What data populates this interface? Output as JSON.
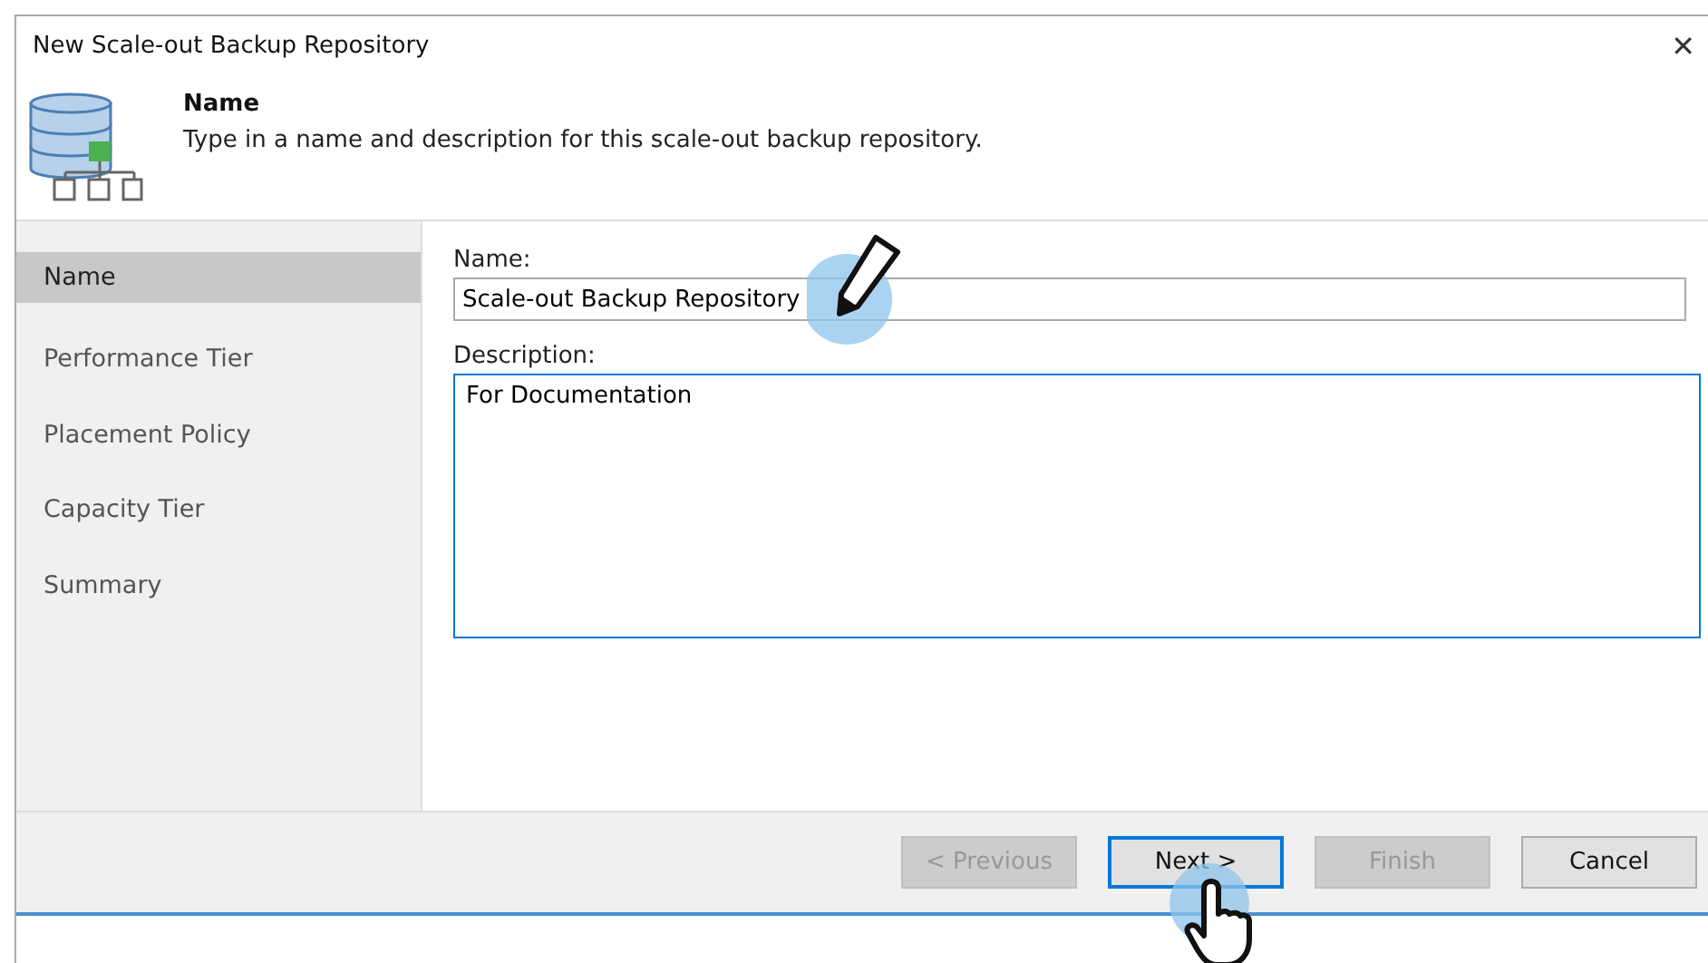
{
  "window": {
    "title": "New Scale-out Backup Repository",
    "close": "✕"
  },
  "header": {
    "title": "Name",
    "description": "Type in a name and description for this scale-out backup repository."
  },
  "steps": [
    {
      "label": "Name",
      "selected": true
    },
    {
      "label": "Performance Tier",
      "selected": false
    },
    {
      "label": "Placement Policy",
      "selected": false
    },
    {
      "label": "Capacity Tier",
      "selected": false
    },
    {
      "label": "Summary",
      "selected": false
    }
  ],
  "form": {
    "name": {
      "label": "Name:",
      "value": "Scale-out Backup Repository",
      "focused": false
    },
    "description": {
      "label": "Description:",
      "value": "For Documentation",
      "focused": true
    }
  },
  "buttons": [
    {
      "label": "< Previous",
      "disabled": true,
      "default": false
    },
    {
      "label": "Next >",
      "disabled": false,
      "default": true
    },
    {
      "label": "Finish",
      "disabled": true,
      "default": false
    },
    {
      "label": "Cancel",
      "disabled": false,
      "default": false
    }
  ]
}
